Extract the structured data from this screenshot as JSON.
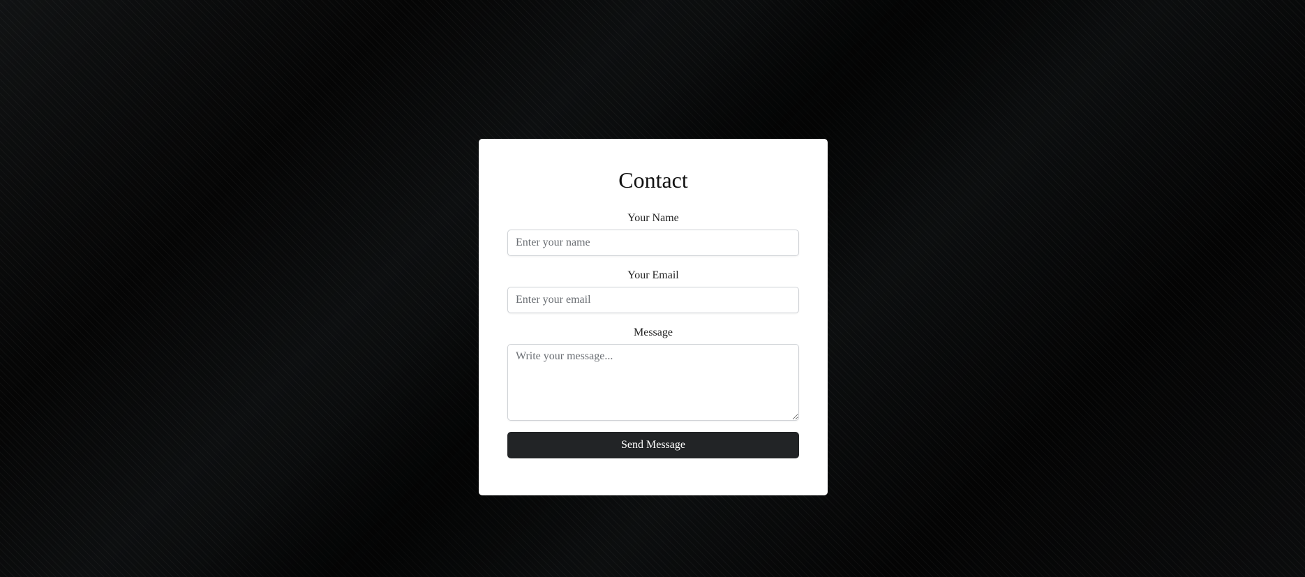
{
  "form": {
    "title": "Contact",
    "name": {
      "label": "Your Name",
      "placeholder": "Enter your name",
      "value": ""
    },
    "email": {
      "label": "Your Email",
      "placeholder": "Enter your email",
      "value": ""
    },
    "message": {
      "label": "Message",
      "placeholder": "Write your message...",
      "value": ""
    },
    "submit_label": "Send Message"
  },
  "colors": {
    "background": "#0b0c0d",
    "card": "#ffffff",
    "button": "#222426",
    "button_text": "#ffffff"
  }
}
